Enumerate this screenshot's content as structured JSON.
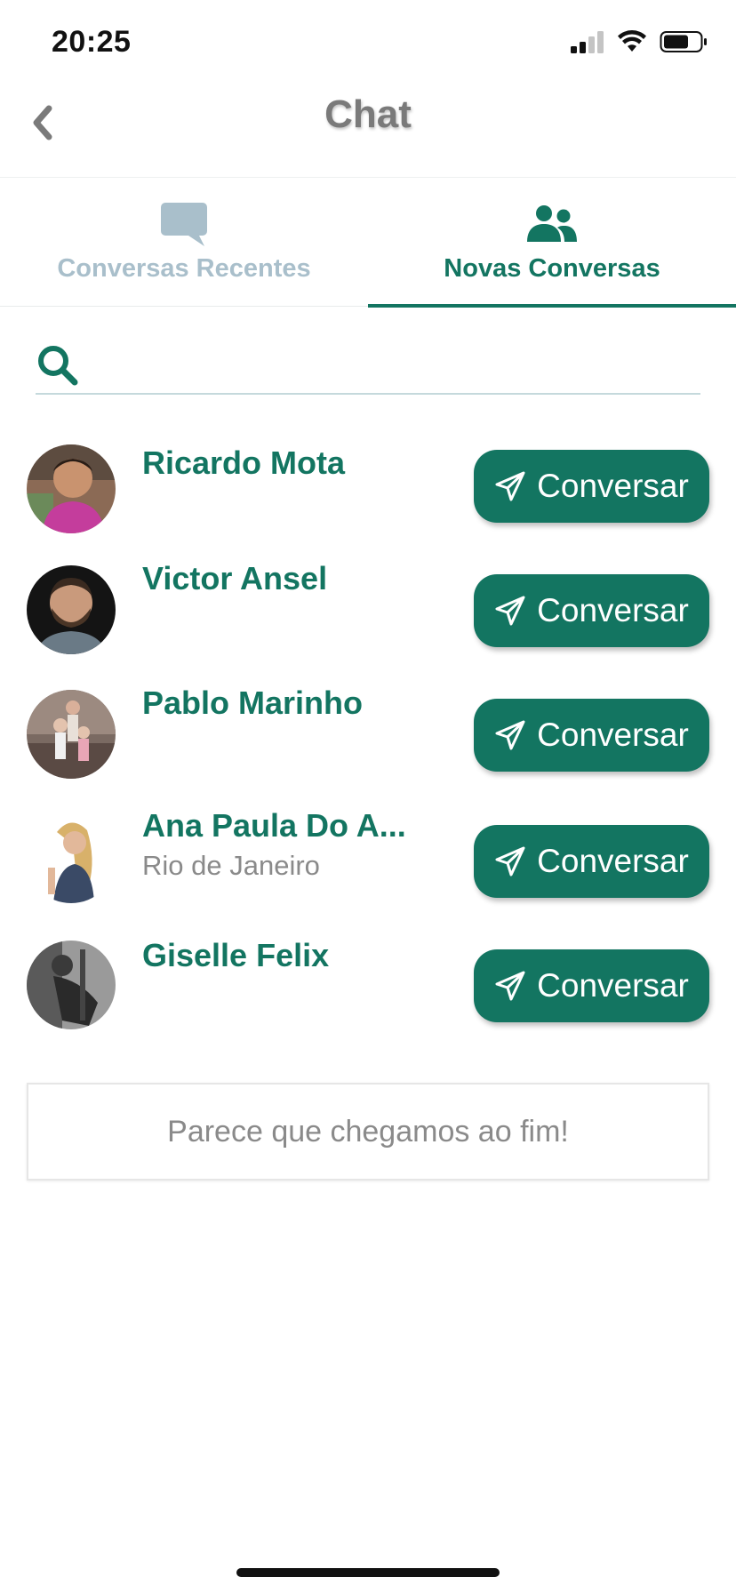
{
  "status_bar": {
    "time": "20:25"
  },
  "nav": {
    "title": "Chat",
    "back_icon": "chevron-left-icon"
  },
  "tabs": [
    {
      "label": "Conversas Recentes",
      "icon": "chat-bubble-icon",
      "active": false
    },
    {
      "label": "Novas Conversas",
      "icon": "users-icon",
      "active": true
    }
  ],
  "search": {
    "value": "",
    "placeholder": ""
  },
  "contacts": [
    {
      "name": "Ricardo Mota",
      "city": "",
      "button_label": "Conversar"
    },
    {
      "name": "Victor Ansel",
      "city": "",
      "button_label": "Conversar"
    },
    {
      "name": "Pablo Marinho",
      "city": "",
      "button_label": "Conversar"
    },
    {
      "name": "Ana Paula Do A...",
      "city": "Rio de Janeiro",
      "button_label": "Conversar"
    },
    {
      "name": "Giselle Felix",
      "city": "",
      "button_label": "Conversar"
    }
  ],
  "end_message": "Parece que chegamos ao fim!",
  "colors": {
    "accent": "#137561",
    "inactive": "#a9bfcb",
    "title": "#7a7a7a"
  }
}
